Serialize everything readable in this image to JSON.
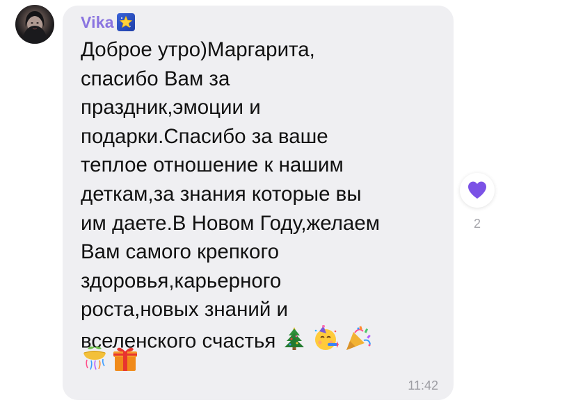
{
  "message": {
    "sender_name": "Vika",
    "sender_badge_icon": "star-emoji",
    "text_lines": [
      "Доброе утро)Маргарита,",
      "спасибо Вам за",
      "праздник,эмоции и",
      "подарки.Спасибо за ваше",
      "теплое отношение к нашим",
      "деткам,за знания которые вы",
      "им даете.В Новом Году,желаем",
      "Вам самого крепкого",
      "здоровья,карьерного",
      "роста,новых знаний и",
      "вселенского счастья"
    ],
    "trailing_emojis": [
      "christmas-tree-emoji",
      "party-face-emoji",
      "party-popper-emoji"
    ],
    "second_row_emojis": [
      "confetti-ball-emoji",
      "gift-emoji"
    ],
    "time": "11:42"
  },
  "reaction": {
    "icon": "purple-heart-icon",
    "count": "2"
  },
  "colors": {
    "sender_name": "#8a74e0",
    "bubble_bg": "#efeff2",
    "heart": "#7b52e6",
    "meta_text": "#9d9da3"
  }
}
